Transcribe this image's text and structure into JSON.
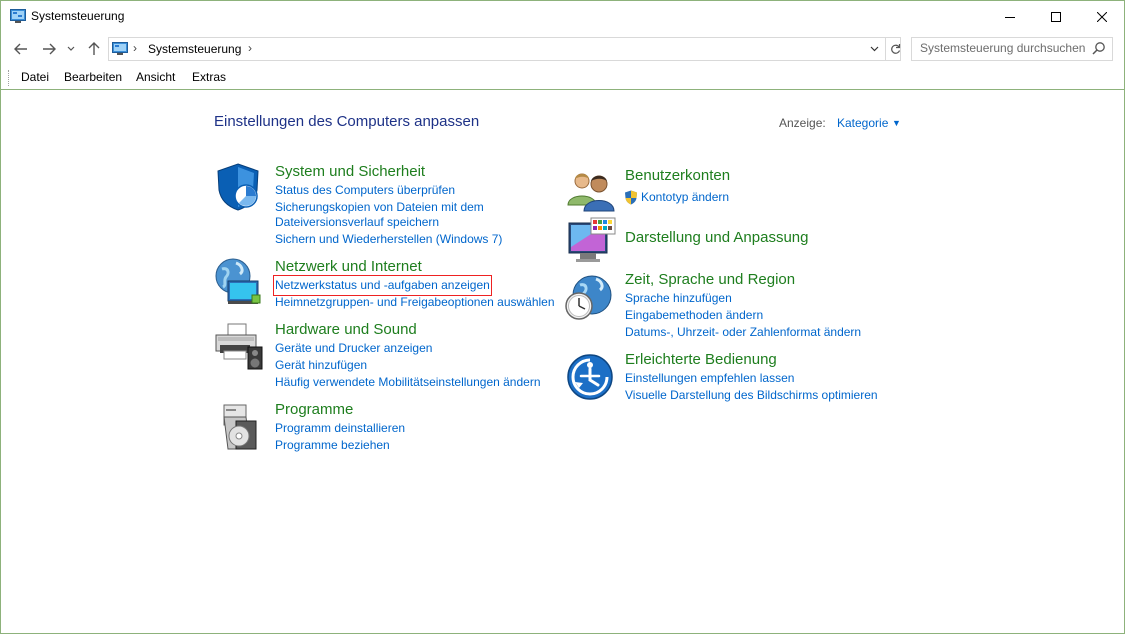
{
  "window": {
    "title": "Systemsteuerung",
    "controls": {
      "minimize": "—",
      "maximize": "☐",
      "close": "✕"
    }
  },
  "nav": {
    "back": "←",
    "forward": "→",
    "recent": "⌄",
    "up": "↑",
    "breadcrumb": [
      "Systemsteuerung"
    ],
    "search_placeholder": "Systemsteuerung durchsuchen"
  },
  "menu": [
    "Datei",
    "Bearbeiten",
    "Ansicht",
    "Extras"
  ],
  "content": {
    "heading": "Einstellungen des Computers anpassen",
    "view_label": "Anzeige:",
    "view_value": "Kategorie",
    "categories": [
      {
        "title": "System und Sicherheit",
        "icon": "shield-icon",
        "links": [
          "Status des Computers überprüfen",
          "Sicherungskopien von Dateien mit dem",
          "Dateiversionsverlauf speichern",
          "Sichern und Wiederherstellen (Windows 7)"
        ]
      },
      {
        "title": "Netzwerk und Internet",
        "icon": "network-globe-icon",
        "links": [
          "Netzwerkstatus und -aufgaben anzeigen",
          "Heimnetzgruppen- und Freigabeoptionen auswählen"
        ]
      },
      {
        "title": "Hardware und Sound",
        "icon": "printer-icon",
        "links": [
          "Geräte und Drucker anzeigen",
          "Gerät hinzufügen",
          "Häufig verwendete Mobilitätseinstellungen ändern"
        ]
      },
      {
        "title": "Programme",
        "icon": "programs-icon",
        "links": [
          "Programm deinstallieren",
          "Programme beziehen"
        ]
      },
      {
        "title": "Benutzerkonten",
        "icon": "users-icon",
        "links": [
          "Kontotyp ändern"
        ]
      },
      {
        "title": "Darstellung und Anpassung",
        "icon": "monitor-palette-icon",
        "links": []
      },
      {
        "title": "Zeit, Sprache und Region",
        "icon": "clock-globe-icon",
        "links": [
          "Sprache hinzufügen",
          "Eingabemethoden ändern",
          "Datums-, Uhrzeit- oder Zahlenformat ändern"
        ]
      },
      {
        "title": "Erleichterte Bedienung",
        "icon": "accessibility-icon",
        "links": [
          "Einstellungen empfehlen lassen",
          "Visuelle Darstellung des Bildschirms optimieren"
        ]
      }
    ]
  },
  "colors": {
    "category_title": "#1e7e1e",
    "link": "#0066cc",
    "heading": "#1e3287",
    "window_border": "#8db27b",
    "focus_outline": "#e22222"
  }
}
